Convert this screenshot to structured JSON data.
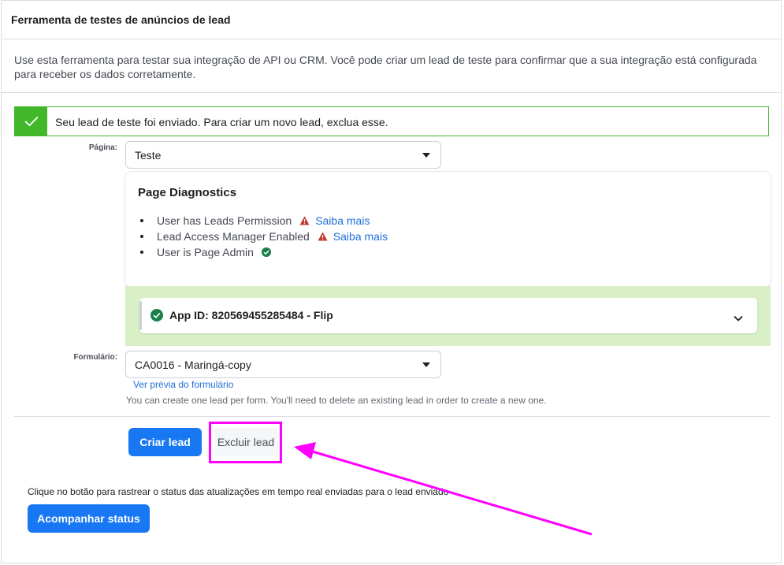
{
  "header": {
    "title": "Ferramenta de testes de anúncios de lead"
  },
  "description": "Use esta ferramenta para testar sua integração de API ou CRM. Você pode criar um lead de teste para confirmar que a sua integração está configurada para receber os dados corretamente.",
  "alert": {
    "message": "Seu lead de teste foi enviado. Para criar um novo lead, exclua esse.",
    "color": "#42b72a"
  },
  "page_field": {
    "label": "Página:",
    "value": "Teste"
  },
  "diagnostics": {
    "title": "Page Diagnostics",
    "items": [
      {
        "label": "User has Leads Permission",
        "status": "warning",
        "icon": "warning-icon",
        "link": "Saiba mais"
      },
      {
        "label": "Lead Access Manager Enabled",
        "status": "warning",
        "icon": "warning-icon",
        "link": "Saiba mais"
      },
      {
        "label": "User is Page Admin",
        "status": "ok",
        "icon": "check-circle-icon"
      }
    ]
  },
  "app": {
    "title": "App ID: 820569455285484 - Flip",
    "status_color": "#1a7f4b"
  },
  "form_field": {
    "label": "Formulário:",
    "value": "CA0016 - Maringá-copy",
    "preview_link": "Ver prévia do formulário",
    "hint": "You can create one lead per form. You'll need to delete an existing lead in order to create a new one."
  },
  "actions": {
    "create": "Criar lead",
    "delete": "Excluir lead"
  },
  "tracking": {
    "text": "Clique no botão para rastrear o status das atualizações em tempo real enviadas para o lead enviado",
    "button": "Acompanhar status"
  },
  "colors": {
    "primary": "#1877f2",
    "link": "#216fdb",
    "annotation": "#ff00ff",
    "warning": "#c0392b"
  }
}
